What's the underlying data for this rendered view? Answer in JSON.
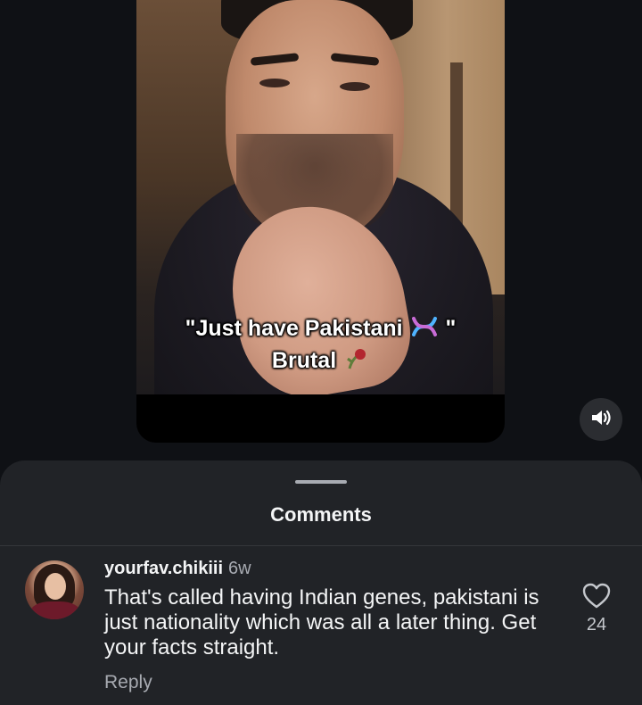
{
  "video": {
    "caption_line1": "\"Just have Pakistani",
    "caption_quote_close": "\"",
    "caption_line2": "Brutal",
    "caption_icons": [
      "dna-icon",
      "wilted-rose-icon"
    ],
    "sound_icon": "speaker-on-icon"
  },
  "comments_sheet": {
    "title": "Comments",
    "comments": [
      {
        "username": "yourfav.chikiii",
        "age": "6w",
        "text": "That's called having Indian genes, pakistani is just nationality which was all a later thing. Get your facts straight.",
        "like_count": "24",
        "reply_label": "Reply"
      }
    ]
  },
  "colors": {
    "background": "#0f1115",
    "sheet": "#212327",
    "text_primary": "#f4f5f6",
    "text_secondary": "#a8abb2"
  }
}
